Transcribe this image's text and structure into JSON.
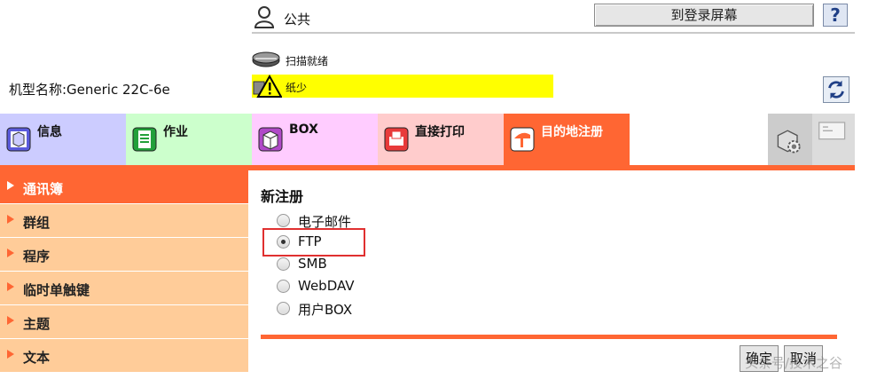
{
  "header": {
    "user_label": "公共",
    "logout_label": "到登录屏幕",
    "help_label": "?"
  },
  "status": {
    "scan_ready": "扫描就绪",
    "paper_low": "纸少",
    "paper_low_color": "#ffff00"
  },
  "model_name": "机型名称:Generic 22C-6e",
  "tabs": [
    {
      "label": "信息",
      "icon": "info-icon",
      "color": "#ccccff"
    },
    {
      "label": "作业",
      "icon": "job-icon",
      "color": "#ccffcc"
    },
    {
      "label": "BOX",
      "icon": "box-icon",
      "color": "#ffccff"
    },
    {
      "label": "直接打印",
      "icon": "direct-print-icon",
      "color": "#ffcccc"
    },
    {
      "label": "目的地注册",
      "icon": "destination-register-icon",
      "color": "#ff6633",
      "active": true
    }
  ],
  "sidebar": {
    "items": [
      {
        "label": "通讯簿",
        "active": true
      },
      {
        "label": "群组"
      },
      {
        "label": "程序"
      },
      {
        "label": "临时单触键"
      },
      {
        "label": "主题"
      },
      {
        "label": "文本"
      }
    ]
  },
  "main": {
    "title": "新注册",
    "options": [
      {
        "label": "电子邮件",
        "checked": false
      },
      {
        "label": "FTP",
        "checked": true
      },
      {
        "label": "SMB",
        "checked": false
      },
      {
        "label": "WebDAV",
        "checked": false
      },
      {
        "label": "用户BOX",
        "checked": false
      }
    ],
    "ok_label": "确定",
    "cancel_label": "取消"
  },
  "watermark": "头条号/技术之谷",
  "colors": {
    "accent": "#ff6633",
    "sidebar": "#ffcc99",
    "highlight": "#e03030"
  }
}
